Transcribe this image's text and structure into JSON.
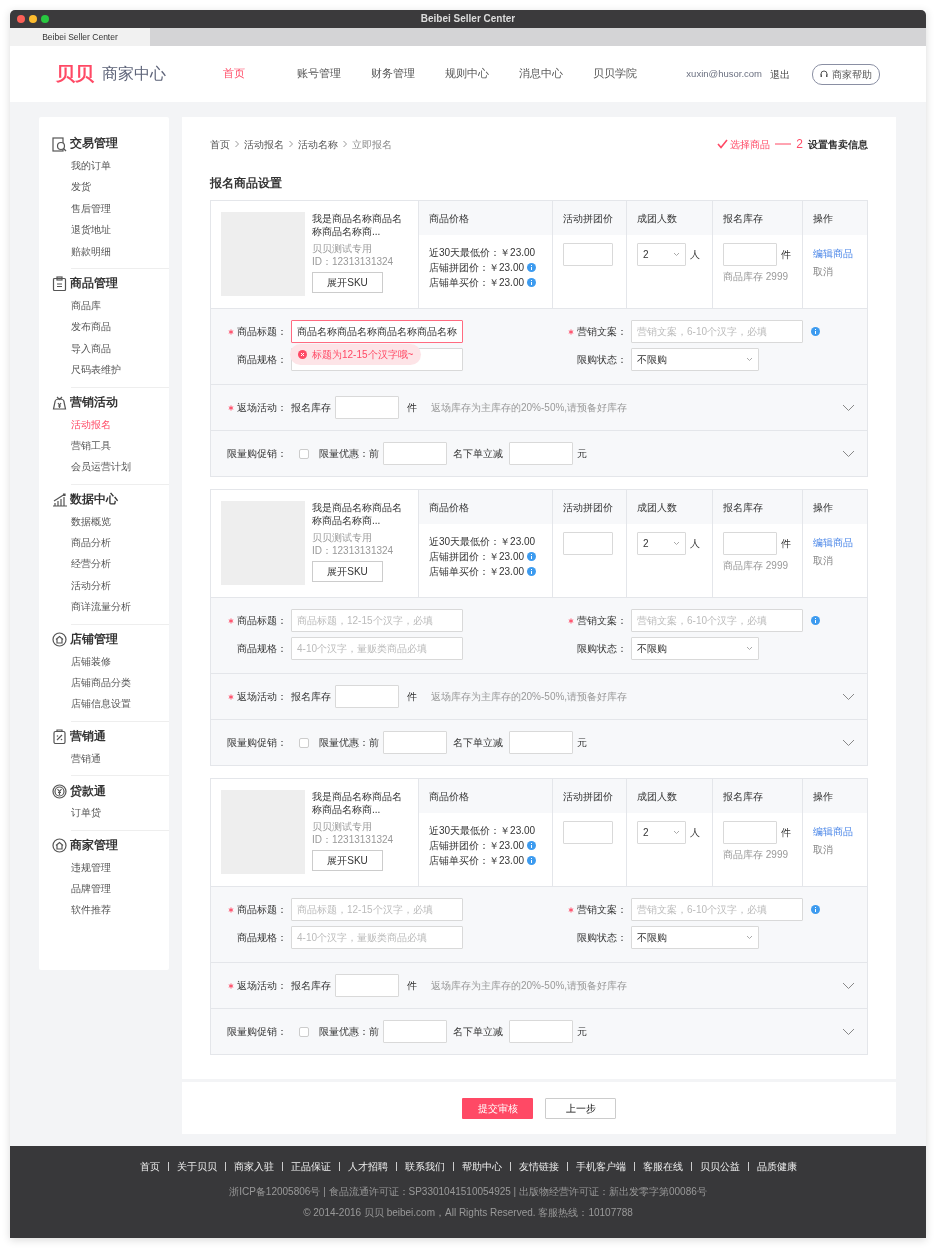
{
  "window": {
    "title": "Beibei Seller Center"
  },
  "browser_tab": {
    "label": "Beibei Seller Center"
  },
  "header": {
    "logo_mark": "贝贝",
    "logo_text": "商家中心",
    "nav": [
      {
        "label": "首页",
        "selected": true
      },
      {
        "label": "账号管理",
        "selected": false
      },
      {
        "label": "财务管理",
        "selected": false
      },
      {
        "label": "规则中心",
        "selected": false
      },
      {
        "label": "消息中心",
        "selected": false
      },
      {
        "label": "贝贝学院",
        "selected": false
      }
    ],
    "user": "xuxin@husor.com",
    "logout": "退出",
    "help": "商家帮助"
  },
  "sidebar": {
    "groups": [
      {
        "title": "交易管理",
        "items": [
          {
            "label": "我的订单",
            "selected": false
          },
          {
            "label": "发货",
            "selected": false
          },
          {
            "label": "售后管理",
            "selected": false
          },
          {
            "label": "退货地址",
            "selected": false
          },
          {
            "label": "赔款明细",
            "selected": false
          }
        ]
      },
      {
        "title": "商品管理",
        "items": [
          {
            "label": "商品库",
            "selected": false
          },
          {
            "label": "发布商品",
            "selected": false
          },
          {
            "label": "导入商品",
            "selected": false
          },
          {
            "label": "尺码表维护",
            "selected": false
          }
        ]
      },
      {
        "title": "营销活动",
        "items": [
          {
            "label": "活动报名",
            "selected": true
          },
          {
            "label": "营销工具",
            "selected": false
          },
          {
            "label": "会员运营计划",
            "selected": false
          }
        ]
      },
      {
        "title": "数据中心",
        "items": [
          {
            "label": "数据概览",
            "selected": false
          },
          {
            "label": "商品分析",
            "selected": false
          },
          {
            "label": "经营分析",
            "selected": false
          },
          {
            "label": "活动分析",
            "selected": false
          },
          {
            "label": "商详流量分析",
            "selected": false
          }
        ]
      },
      {
        "title": "店铺管理",
        "items": [
          {
            "label": "店铺装修",
            "selected": false
          },
          {
            "label": "店铺商品分类",
            "selected": false
          },
          {
            "label": "店铺信息设置",
            "selected": false
          }
        ]
      },
      {
        "title": "营销通",
        "items": [
          {
            "label": "营销通",
            "selected": false
          }
        ]
      },
      {
        "title": "贷款通",
        "items": [
          {
            "label": "订单贷",
            "selected": false
          }
        ]
      },
      {
        "title": "商家管理",
        "items": [
          {
            "label": "违规管理",
            "selected": false
          },
          {
            "label": "品牌管理",
            "selected": false
          },
          {
            "label": "软件推荐",
            "selected": false
          }
        ]
      }
    ]
  },
  "breadcrumb": [
    "首页",
    "活动报名",
    "活动名称",
    "立即报名"
  ],
  "steps": [
    {
      "kind": "done",
      "label": "选择商品"
    },
    {
      "kind": "current",
      "number": "2",
      "label": "设置售卖信息"
    }
  ],
  "section_title": "报名商品设置",
  "products": [
    {
      "headers": [
        "商品价格",
        "活动拼团价",
        "成团人数",
        "报名库存",
        "操作"
      ],
      "name": "我是商品名称商品名称商品名称商...",
      "shop": "贝贝测试专用",
      "id": "ID：12313131324",
      "sku_button": "展开SKU",
      "prices": [
        {
          "label": "近30天最低价：",
          "value": "￥23.00",
          "info": false
        },
        {
          "label": "店铺拼团价：",
          "value": "￥23.00",
          "info": true
        },
        {
          "label": "店铺单买价：",
          "value": "￥23.00",
          "info": true
        }
      ],
      "group_size": {
        "value": "2",
        "unit": "人"
      },
      "stock": {
        "unit": "件",
        "note": "商品库存 2999"
      },
      "actions": [
        "编辑商品",
        "取消"
      ],
      "title_field": {
        "label": "商品标题：",
        "required": true,
        "value": "商品名称商品名称商品名称商品名称",
        "error": "标题为12-15个汉字哦~"
      },
      "copy_field": {
        "label": "营销文案：",
        "required": true,
        "placeholder": "营销文案，6-10个汉字，必填"
      },
      "spec_field": {
        "label": "商品规格：",
        "required": false
      },
      "limit_field": {
        "label": "限购状态：",
        "value": "不限购"
      },
      "return": {
        "label": "返场活动：",
        "required": true,
        "stock_label": "报名库存",
        "unit": "件",
        "hint": "返场库存为主库存的20%-50%,请预备好库存",
        "expanded": false
      },
      "limited": {
        "label": "限量购促销：",
        "checkbox_label": "限量优惠：前",
        "checked": false,
        "middle": "名下单立减",
        "unit": "元",
        "expanded": false
      }
    },
    {
      "headers": [
        "商品价格",
        "活动拼团价",
        "成团人数",
        "报名库存",
        "操作"
      ],
      "name": "我是商品名称商品名称商品名称商...",
      "shop": "贝贝测试专用",
      "id": "ID：12313131324",
      "sku_button": "展开SKU",
      "prices": [
        {
          "label": "近30天最低价：",
          "value": "￥23.00",
          "info": false
        },
        {
          "label": "店铺拼团价：",
          "value": "￥23.00",
          "info": true
        },
        {
          "label": "店铺单买价：",
          "value": "￥23.00",
          "info": true
        }
      ],
      "group_size": {
        "value": "2",
        "unit": "人"
      },
      "stock": {
        "unit": "件",
        "note": "商品库存 2999"
      },
      "actions": [
        "编辑商品",
        "取消"
      ],
      "title_field": {
        "label": "商品标题：",
        "required": true,
        "placeholder": "商品标题，12-15个汉字，必填"
      },
      "copy_field": {
        "label": "营销文案：",
        "required": true,
        "placeholder": "营销文案，6-10个汉字，必填"
      },
      "spec_field": {
        "label": "商品规格：",
        "required": false,
        "placeholder": "4-10个汉字，量贩类商品必填"
      },
      "limit_field": {
        "label": "限购状态：",
        "value": "不限购"
      },
      "return": {
        "label": "返场活动：",
        "required": true,
        "stock_label": "报名库存",
        "unit": "件",
        "hint": "返场库存为主库存的20%-50%,请预备好库存",
        "expanded": false
      },
      "limited": {
        "label": "限量购促销：",
        "checkbox_label": "限量优惠：前",
        "checked": false,
        "middle": "名下单立减",
        "unit": "元",
        "expanded": false
      }
    },
    {
      "headers": [
        "商品价格",
        "活动拼团价",
        "成团人数",
        "报名库存",
        "操作"
      ],
      "name": "我是商品名称商品名称商品名称商...",
      "shop": "贝贝测试专用",
      "id": "ID：12313131324",
      "sku_button": "展开SKU",
      "prices": [
        {
          "label": "近30天最低价：",
          "value": "￥23.00",
          "info": false
        },
        {
          "label": "店铺拼团价：",
          "value": "￥23.00",
          "info": true
        },
        {
          "label": "店铺单买价：",
          "value": "￥23.00",
          "info": true
        }
      ],
      "group_size": {
        "value": "2",
        "unit": "人"
      },
      "stock": {
        "unit": "件",
        "note": "商品库存 2999"
      },
      "actions": [
        "编辑商品",
        "取消"
      ],
      "title_field": {
        "label": "商品标题：",
        "required": true,
        "placeholder": "商品标题，12-15个汉字，必填"
      },
      "copy_field": {
        "label": "营销文案：",
        "required": true,
        "placeholder": "营销文案，6-10个汉字，必填"
      },
      "spec_field": {
        "label": "商品规格：",
        "required": false,
        "placeholder": "4-10个汉字，量贩类商品必填"
      },
      "limit_field": {
        "label": "限购状态：",
        "value": "不限购"
      },
      "return": {
        "label": "返场活动：",
        "required": true,
        "stock_label": "报名库存",
        "unit": "件",
        "hint": "返场库存为主库存的20%-50%,请预备好库存",
        "expanded": false
      },
      "limited": {
        "label": "限量购促销：",
        "checkbox_label": "限量优惠：前",
        "checked": false,
        "middle": "名下单立减",
        "unit": "元",
        "expanded": false
      }
    }
  ],
  "buttons": {
    "submit": "提交审核",
    "back": "上一步"
  },
  "footer": {
    "links": [
      "首页",
      "关于贝贝",
      "商家入驻",
      "正品保证",
      "人才招聘",
      "联系我们",
      "帮助中心",
      "友情链接",
      "手机客户端",
      "客服在线",
      "贝贝公益",
      "品质健康"
    ],
    "lines": [
      "浙ICP备12005806号 | 食品流通许可证：SP3301041510054925 | 出版物经营许可证：新出发零字第00086号",
      "© 2014-2016 贝贝 beibei.com，All Rights Reserved. 客服热线：10107788"
    ]
  }
}
